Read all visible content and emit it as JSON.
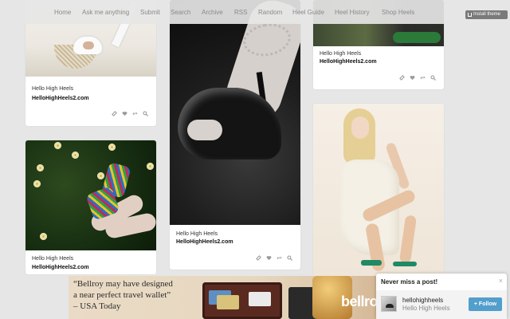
{
  "nav": {
    "items": [
      "Home",
      "Ask me anything",
      "Submit",
      "Search",
      "Archive",
      "RSS",
      "Random",
      "Heel Guide",
      "Heel History",
      "Shop Heels"
    ],
    "install_label": "Install theme"
  },
  "posts": [
    {
      "title": "Hello High Heels",
      "link": "HelloHighHeels2.com",
      "photo": "white-platform-heels-photo"
    },
    {
      "title": "Hello High Heels",
      "link": "HelloHighHeels2.com",
      "photo": "black-patent-heels-chain-anklet-photo"
    },
    {
      "title": "Hello High Heels",
      "link": "HelloHighHeels2.com",
      "photo": "green-heels-photo"
    },
    {
      "title": "Hello High Heels",
      "link": "HelloHighHeels2.com",
      "photo": "floral-heels-daffodils-photo"
    },
    {
      "title": "",
      "link": "",
      "photo": "model-white-dress-green-heels-photo"
    }
  ],
  "post_actions": [
    "link-icon",
    "heart-icon",
    "reblog-icon",
    "search-icon"
  ],
  "ad": {
    "line1": "“Bellroy may have designed",
    "line2": "a near perfect travel wallet”",
    "line3": "– USA Today",
    "brand": "bellroy"
  },
  "follow_popup": {
    "title": "Never miss a post!",
    "close": "×",
    "username": "hellohighheels",
    "blog_title": "Hello High Heels",
    "button": "+ Follow"
  },
  "colors": {
    "background": "#e6e6e6",
    "nav_text": "#8a8a8a",
    "follow_button": "#529ecc",
    "icon_gray": "#9a9a9a"
  }
}
